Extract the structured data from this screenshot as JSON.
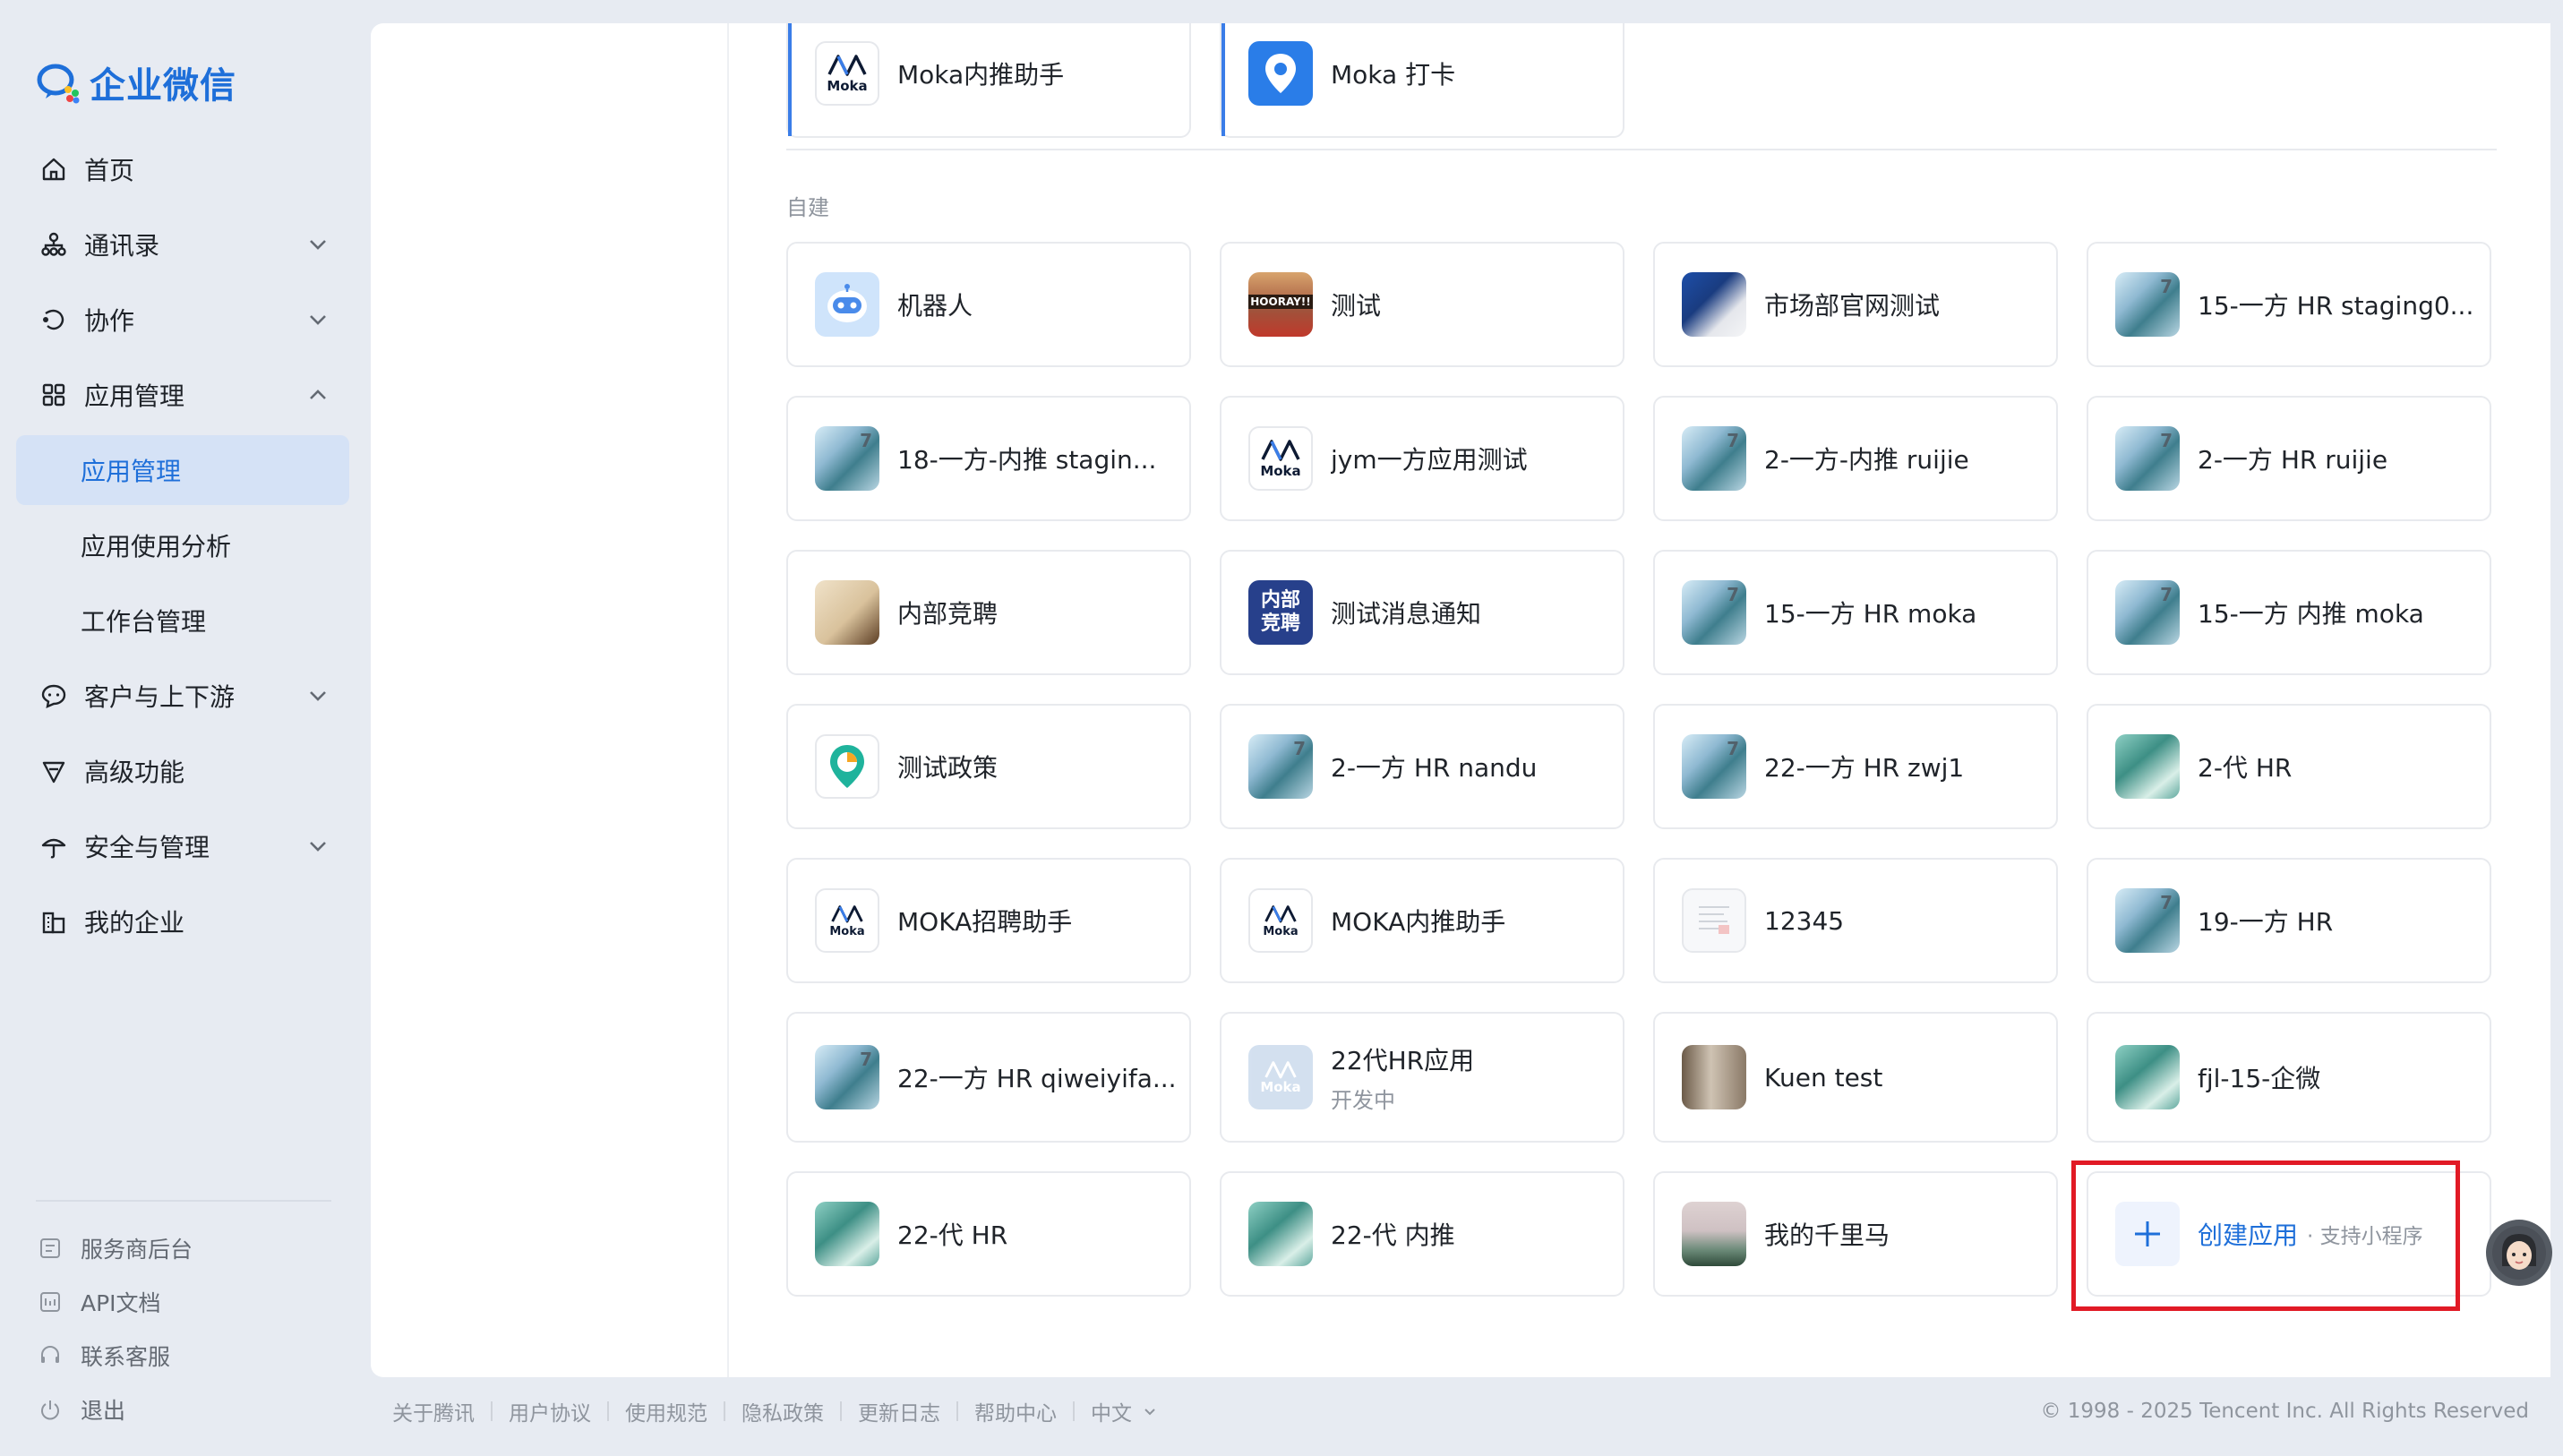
{
  "sidebar": {
    "brand": "企业微信",
    "nav": [
      {
        "label": "首页",
        "icon": "home-icon"
      },
      {
        "label": "通讯录",
        "icon": "org-chart-icon"
      },
      {
        "label": "协作",
        "icon": "collab-icon"
      },
      {
        "label": "应用管理",
        "icon": "apps-grid-icon"
      },
      {
        "label": "客户与上下游",
        "icon": "chat-bubble-icon"
      },
      {
        "label": "高级功能",
        "icon": "diamond-icon"
      },
      {
        "label": "安全与管理",
        "icon": "umbrella-icon"
      },
      {
        "label": "我的企业",
        "icon": "building-icon"
      }
    ],
    "sub_nav": [
      {
        "label": "应用管理",
        "active": true
      },
      {
        "label": "应用使用分析",
        "active": false
      },
      {
        "label": "工作台管理",
        "active": false
      }
    ],
    "footer": [
      {
        "label": "服务商后台",
        "icon": "service-icon"
      },
      {
        "label": "API文档",
        "icon": "api-doc-icon"
      },
      {
        "label": "联系客服",
        "icon": "headset-icon"
      },
      {
        "label": "退出",
        "icon": "power-icon"
      }
    ]
  },
  "top_apps": [
    {
      "name": "Moka内推助手",
      "icon": "moka-logo-icon"
    },
    {
      "name": "Moka 打卡",
      "icon": "location-pin-icon"
    }
  ],
  "section": {
    "title": "自建"
  },
  "apps": [
    {
      "name": "机器人",
      "icon": "robot-icon"
    },
    {
      "name": "测试",
      "icon": "hooray-photo-icon"
    },
    {
      "name": "市场部官网测试",
      "icon": "market-photo-icon"
    },
    {
      "name": "15-一方 HR staging0...",
      "icon": "anime-girl-icon"
    },
    {
      "name": "18-一方-内推 stagin...",
      "icon": "anime-girl-icon"
    },
    {
      "name": "jym一方应用测试",
      "icon": "moka-logo-icon"
    },
    {
      "name": "2-一方-内推 ruijie",
      "icon": "anime-girl-icon"
    },
    {
      "name": "2-一方 HR ruijie",
      "icon": "anime-girl-icon"
    },
    {
      "name": "内部竞聘",
      "icon": "paper-note-icon"
    },
    {
      "name": "测试消息通知",
      "icon": "neibu-jingpin-icon"
    },
    {
      "name": "15-一方 HR moka",
      "icon": "anime-girl-icon"
    },
    {
      "name": "15-一方 内推 moka",
      "icon": "anime-girl-icon"
    },
    {
      "name": "测试政策",
      "icon": "pie-pin-icon"
    },
    {
      "name": "2-一方 HR nandu",
      "icon": "anime-girl-icon"
    },
    {
      "name": "22-一方 HR zwj1",
      "icon": "anime-girl-icon"
    },
    {
      "name": "2-代 HR",
      "icon": "green-anime-icon"
    },
    {
      "name": "MOKA招聘助手",
      "icon": "moka-logo-icon"
    },
    {
      "name": "MOKA内推助手",
      "icon": "moka-logo-icon"
    },
    {
      "name": "12345",
      "icon": "document-icon"
    },
    {
      "name": "19-一方 HR",
      "icon": "anime-girl-icon"
    },
    {
      "name": "22-一方 HR qiweiyifa...",
      "icon": "anime-girl-icon"
    },
    {
      "name": "22代HR应用",
      "sub": "开发中",
      "icon": "moka-ghost-icon"
    },
    {
      "name": "Kuen test",
      "icon": "kuen-photo-icon"
    },
    {
      "name": "fjl-15-企微",
      "icon": "green-anime-icon"
    },
    {
      "name": "22-代 HR",
      "icon": "green-anime-icon"
    },
    {
      "name": "22-代 内推",
      "icon": "green-anime-icon"
    },
    {
      "name": "我的千里马",
      "icon": "landscape-icon"
    }
  ],
  "create": {
    "label": "创建应用",
    "sub": "· 支持小程序",
    "icon": "plus-icon"
  },
  "footer": {
    "links": [
      "关于腾讯",
      "用户协议",
      "使用规范",
      "隐私政策",
      "更新日志",
      "帮助中心",
      "中文"
    ],
    "copyright": "© 1998 - 2025 Tencent Inc. All Rights Reserved"
  },
  "colors": {
    "accent": "#1e6fd9",
    "highlight": "#e11a25",
    "active_bg": "#d5e2f6"
  }
}
